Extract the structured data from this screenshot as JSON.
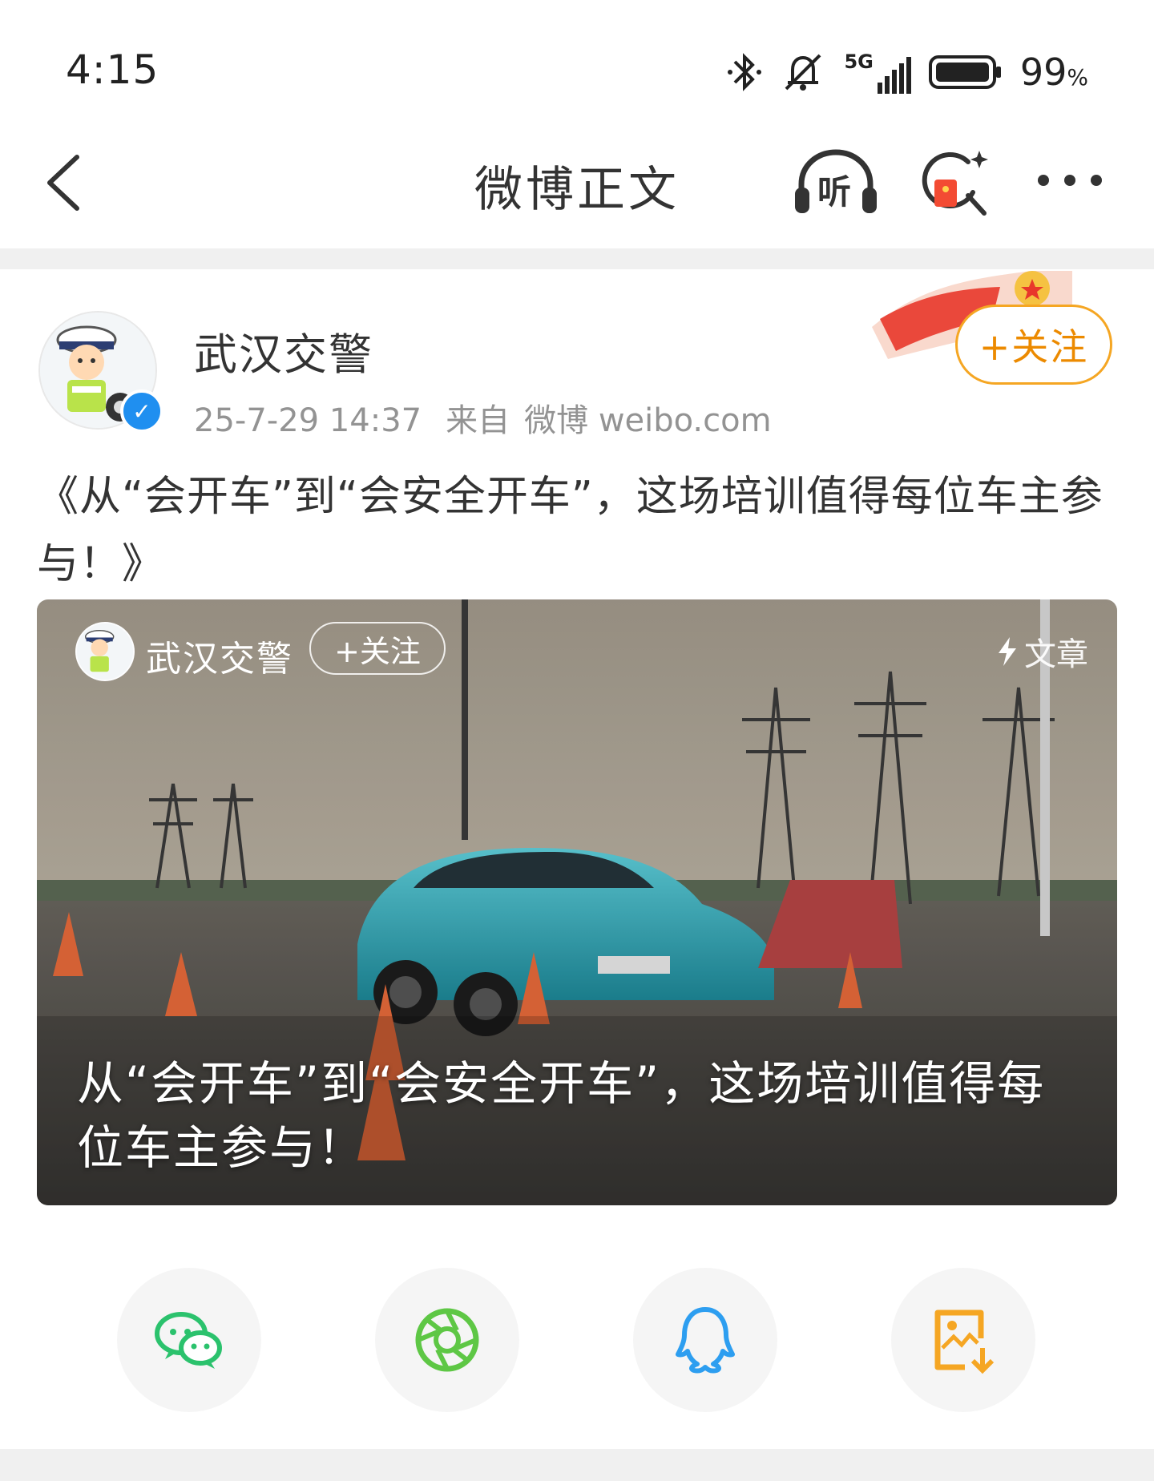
{
  "status_bar": {
    "time": "4:15",
    "network": "5G",
    "battery": "99",
    "battery_unit": "%"
  },
  "nav": {
    "title": "微博正文",
    "listen_label": "听"
  },
  "post": {
    "author": "武汉交警",
    "date": "25-7-29 14:37",
    "source_prefix": "来自",
    "source": "微博 weibo.com",
    "follow_label": "+关注",
    "text": "《从“会开车”到“会安全开车”，这场培训值得每位车主参与！》"
  },
  "card": {
    "author": "武汉交警",
    "follow_label": "+关注",
    "type_label": "文章",
    "headline": "从“会开车”到“会安全开车”，这场培训值得每位车主参与！"
  },
  "share": {
    "items": [
      "wechat-icon",
      "moments-icon",
      "qq-icon",
      "save-image-icon"
    ],
    "colors": {
      "wechat": "#2bc26d",
      "moments": "#5ec745",
      "qq": "#2d9ef0",
      "save": "#f5a623"
    }
  },
  "colors": {
    "accent": "#f5a623",
    "verified": "#1f8ff0"
  }
}
